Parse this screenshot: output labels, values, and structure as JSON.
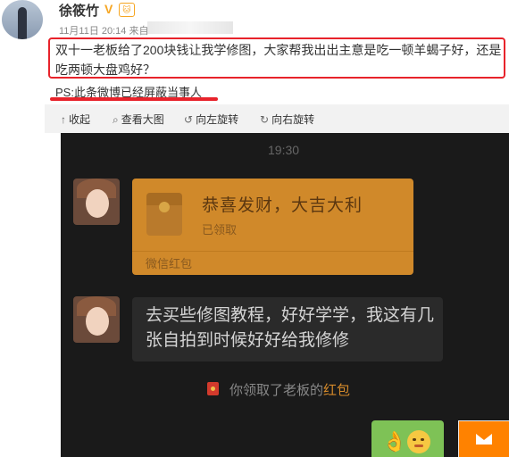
{
  "post": {
    "username": "徐筱竹",
    "verified_badge": "V",
    "level_badge": "",
    "timestamp": "11月11日 20:14 来自",
    "text": "双十一老板给了200块钱让我学修图，大家帮我出出主意是吃一顿羊蝎子好，还是吃两顿大盘鸡好？",
    "ps": "PS:此条微博已经屏蔽当事人"
  },
  "toolbar": {
    "collapse": "收起",
    "view_large": "查看大图",
    "rotate_left": "向左旋转",
    "rotate_right": "向右旋转"
  },
  "chat": {
    "time": "19:30",
    "red_packet": {
      "title": "恭喜发财，大吉大利",
      "status": "已领取",
      "footer": "微信红包"
    },
    "message": "去买些修图教程，好好学学，我这有几张自拍到时候好好给我修修",
    "system": {
      "prefix": "你领取了老板的",
      "link": "红包"
    }
  },
  "icons": {
    "collapse": "collapse-icon",
    "view_large": "zoom-icon",
    "rotate_left": "rotate-left-icon",
    "rotate_right": "rotate-right-icon",
    "mail": "mail-icon"
  },
  "colors": {
    "highlight_red": "#e8232b",
    "red_packet": "#d0892a",
    "wechat_green": "#7ec256",
    "mail_orange": "#ff8200"
  }
}
